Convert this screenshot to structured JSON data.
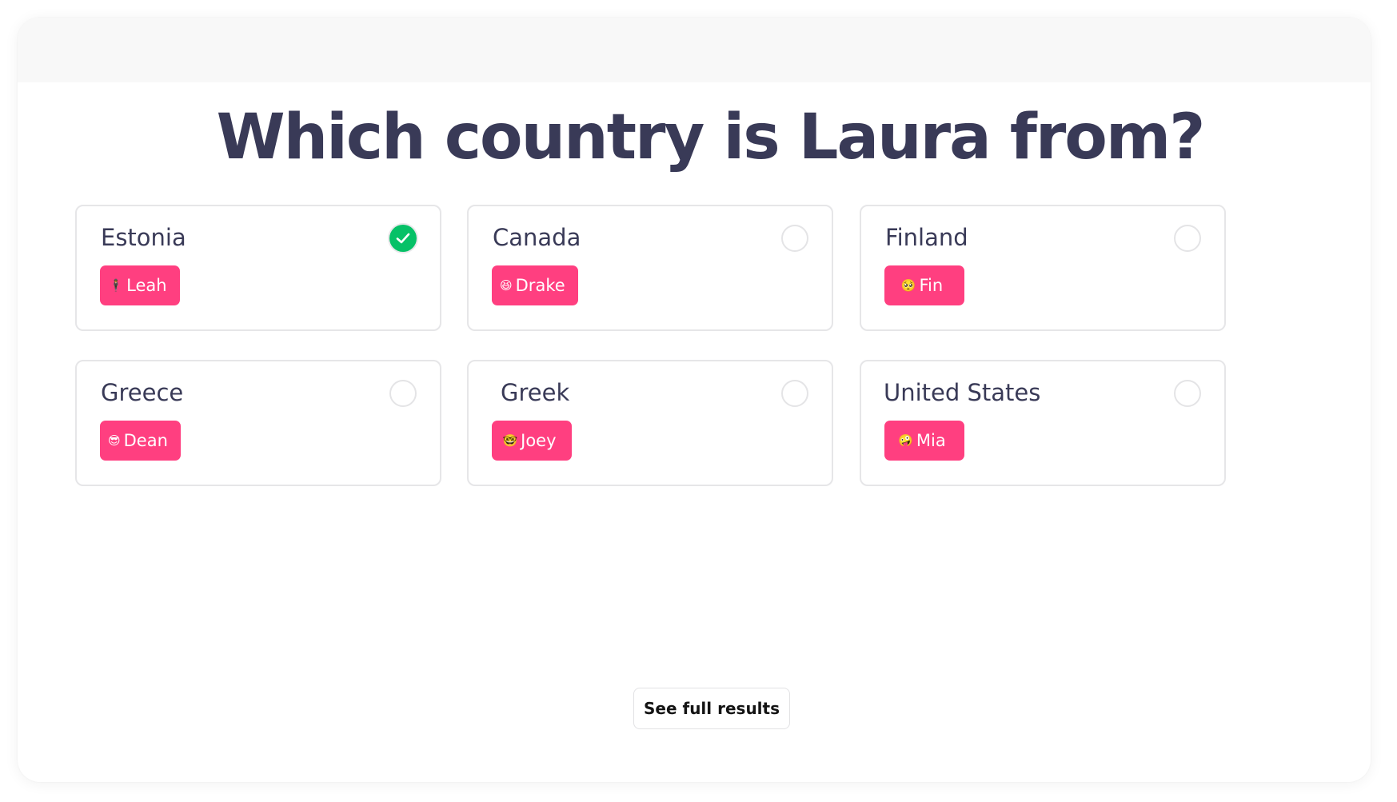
{
  "question": "Which country is Laura from?",
  "options": [
    {
      "label": "Estonia",
      "checked": true,
      "answer": {
        "emoji": "🕴",
        "name": "Leah"
      }
    },
    {
      "label": "Canada",
      "checked": false,
      "answer": {
        "emoji": "😆",
        "name": "Drake"
      }
    },
    {
      "label": "Finland",
      "checked": false,
      "answer": {
        "emoji": "🥺",
        "name": "Fin"
      }
    },
    {
      "label": "Greece",
      "checked": false,
      "answer": {
        "emoji": "😎",
        "name": "Dean"
      }
    },
    {
      "label": "Greek",
      "checked": false,
      "answer": {
        "emoji": "🤓",
        "name": "Joey"
      }
    },
    {
      "label": "United States",
      "checked": false,
      "answer": {
        "emoji": "🤪",
        "name": "Mia"
      }
    }
  ],
  "results_button": "See full results",
  "colors": {
    "tag": "#ff3f80",
    "check": "#06c167",
    "title": "#393a57"
  }
}
